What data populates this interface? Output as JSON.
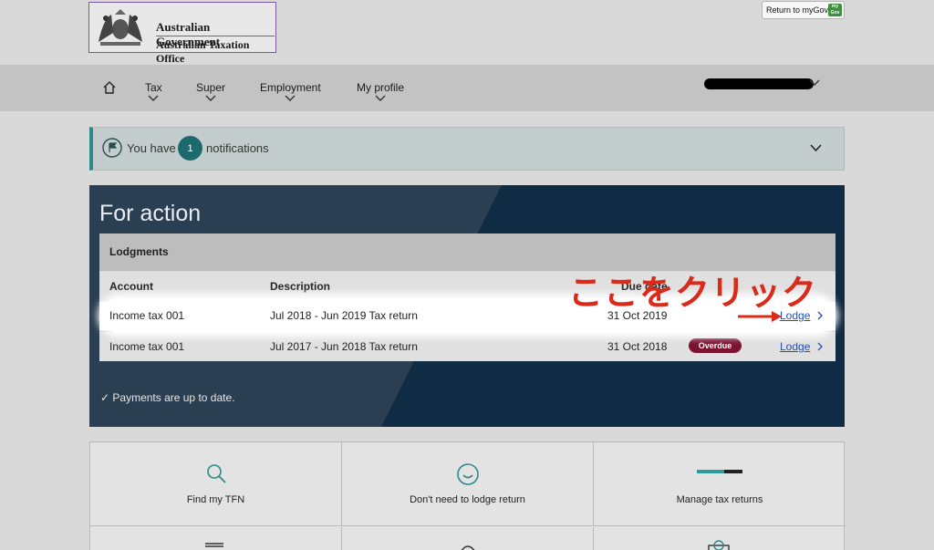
{
  "header": {
    "logo_line1": "Australian Government",
    "logo_line2": "Australian Taxation Office",
    "return_label": "Return to myGov",
    "mygov_badge": "my Gov"
  },
  "nav": {
    "items": [
      {
        "label": "Tax"
      },
      {
        "label": "Super"
      },
      {
        "label": "Employment"
      },
      {
        "label": "My profile"
      }
    ]
  },
  "notifications": {
    "prefix": "You have",
    "count": "1",
    "suffix": "notifications"
  },
  "for_action": {
    "title": "For action",
    "lodgments": {
      "title": "Lodgments",
      "columns": [
        "Account",
        "Description",
        "Due date"
      ],
      "rows": [
        {
          "account": "Income tax 001",
          "description": "Jul 2018 - Jun 2019 Tax return",
          "due_date": "31 Oct 2019",
          "status": "",
          "action": "Lodge"
        },
        {
          "account": "Income tax 001",
          "description": "Jul 2017 - Jun 2018 Tax return",
          "due_date": "31 Oct 2018",
          "status": "Overdue",
          "action": "Lodge"
        }
      ]
    },
    "payments_status": "Payments are up to date."
  },
  "annotation": {
    "text": "ここをクリック",
    "color": "#d92a1a"
  },
  "tiles": [
    {
      "label": "Find my TFN",
      "icon": "search-icon"
    },
    {
      "label": "Don't need to lodge return",
      "icon": "smiley-icon"
    },
    {
      "label": "Manage tax returns",
      "icon": "progress-bar-icon"
    }
  ],
  "colors": {
    "teal": "#1c6a6e",
    "navy": "#102b44",
    "overdue": "#7b1230",
    "link": "#1f4fbf"
  }
}
